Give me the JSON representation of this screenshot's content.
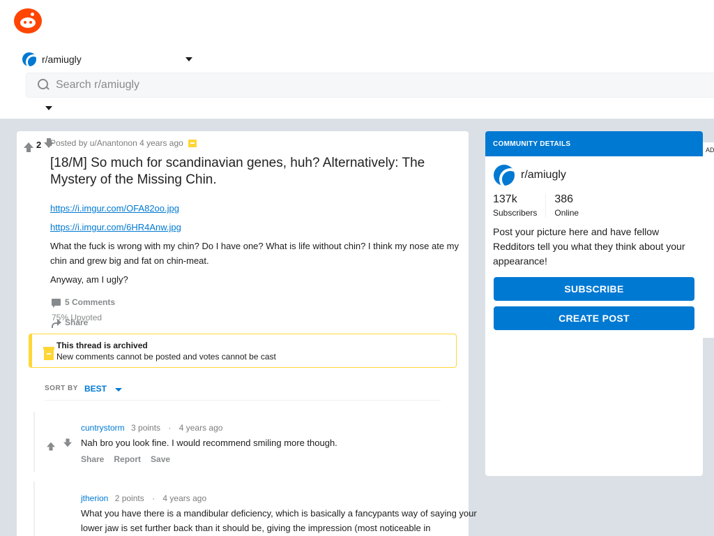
{
  "header": {
    "subreddit": "r/amiugly",
    "search_placeholder": "Search r/amiugly"
  },
  "post": {
    "score": "2",
    "meta": "Posted by u/Anantonon 4 years ago",
    "title": "[18/M] So much for scandinavian genes, huh? Alternatively: The Mystery of the Missing Chin.",
    "link1": "https://i.imgur.com/OFA82oo.jpg",
    "link2": "https://i.imgur.com/6HR4Anw.jpg",
    "para1": "What the fuck is wrong with my chin? Do I have one? What is life without chin? I think my nose ate my chin and grew big and fat on chin-meat.",
    "para2": "Anyway, am I ugly?",
    "comments_label": "5 Comments",
    "upvoted": "75% Upvoted",
    "share_label": "Share"
  },
  "archived": {
    "title": "This thread is archived",
    "desc": "New comments cannot be posted and votes cannot be cast"
  },
  "sort": {
    "label": "SORT BY",
    "value": "BEST"
  },
  "comments": [
    {
      "author": "cuntrystorm",
      "points": "3 points",
      "dot": "·",
      "time": "4 years ago",
      "text": "Nah bro you look fine. I would recommend smiling more though.",
      "share": "Share",
      "report": "Report",
      "save": "Save"
    },
    {
      "author": "jtherion",
      "points": "2 points",
      "dot": "·",
      "time": "4 years ago",
      "text": "What you have there is a mandibular deficiency, which is basically a fancypants way of saying your lower jaw is set further back than it should be, giving the impression (most noticeable in"
    }
  ],
  "sidebar": {
    "header": "COMMUNITY DETAILS",
    "name": "r/amiugly",
    "subscribers_num": "137k",
    "subscribers_label": "Subscribers",
    "online_num": "386",
    "online_label": "Online",
    "description": "Post your picture here and have fellow Redditors tell you what they think about your appearance!",
    "subscribe_label": "SUBSCRIBE",
    "create_post_label": "CREATE POST"
  },
  "ad_label": "AD",
  "colors": {
    "brand": "#ff4500",
    "accent": "#0079d3",
    "archive": "#ffd635",
    "background": "#dae0e6"
  }
}
